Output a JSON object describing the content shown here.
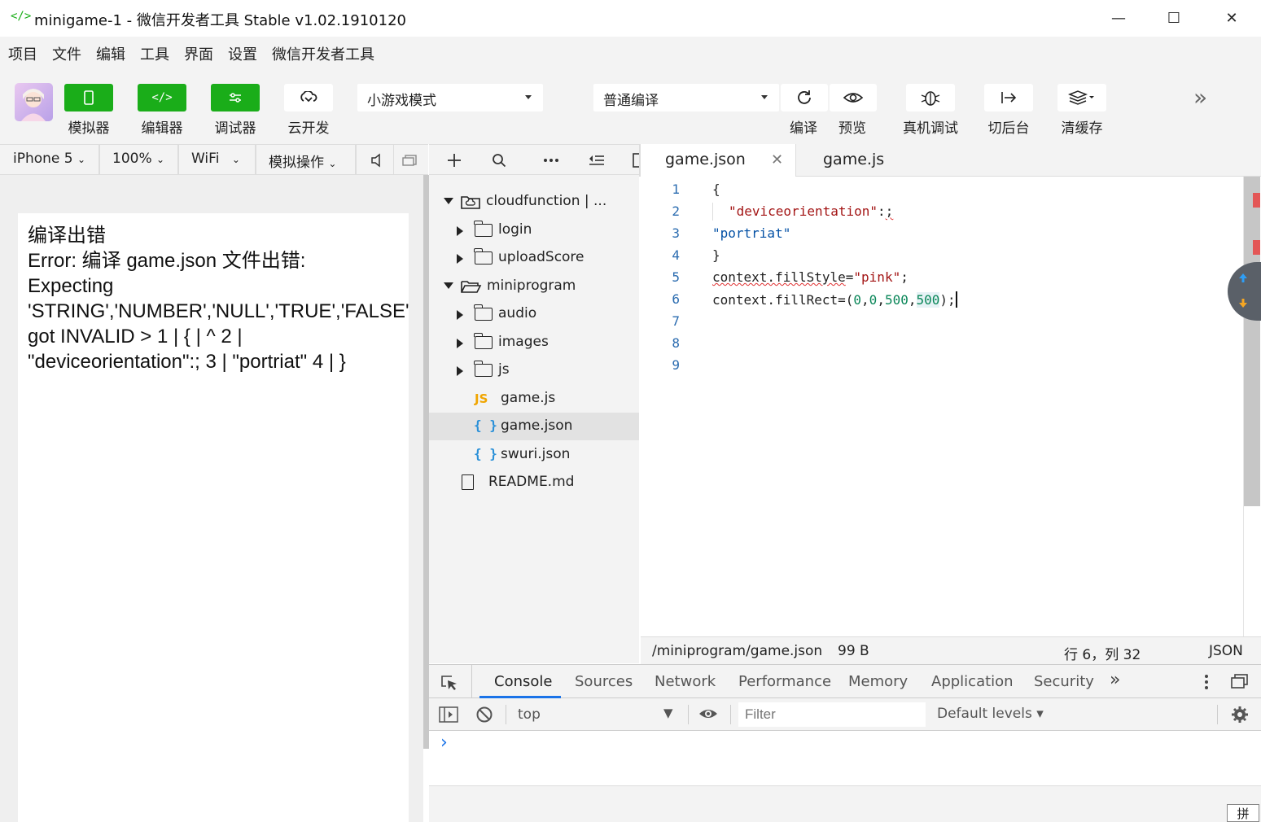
{
  "window": {
    "title": "minigame-1 - 微信开发者工具 Stable v1.02.1910120",
    "app_icon": "</>",
    "minimize": "—",
    "maximize": "☐",
    "close": "✕"
  },
  "menu": [
    "项目",
    "文件",
    "编辑",
    "工具",
    "界面",
    "设置",
    "微信开发者工具"
  ],
  "toolbar": {
    "simulator_label": "模拟器",
    "editor_label": "编辑器",
    "debugger_label": "调试器",
    "cloud_label": "云开发",
    "mode_select": "小游戏模式",
    "compile_select": "普通编译",
    "compile_label": "编译",
    "preview_label": "预览",
    "remote_debug_label": "真机调试",
    "background_label": "切后台",
    "clear_cache_label": "清缓存",
    "more": "»",
    "accent": "#1aad19"
  },
  "simulator_bar": {
    "device": "iPhone 5",
    "zoom": "100%",
    "network": "WiFi",
    "operation": "模拟操作"
  },
  "simulator": {
    "error_text": "编译出错\nError: 编译 game.json 文件出错:\nExpecting\n'STRING','NUMBER','NULL','TRUE','FALSE'\ngot INVALID > 1 | { | ^ 2 |\n\"deviceorientation\":; 3 | \"portriat\" 4 | }"
  },
  "explorer": {
    "items": [
      {
        "label": "cloudfunction | ...",
        "type": "cloud-folder",
        "expanded": true
      },
      {
        "label": "login",
        "type": "folder",
        "expanded": false
      },
      {
        "label": "uploadScore",
        "type": "folder",
        "expanded": false
      },
      {
        "label": "miniprogram",
        "type": "folder",
        "expanded": true
      },
      {
        "label": "audio",
        "type": "folder",
        "expanded": false
      },
      {
        "label": "images",
        "type": "folder",
        "expanded": false
      },
      {
        "label": "js",
        "type": "folder",
        "expanded": false
      },
      {
        "label": "game.js",
        "type": "js"
      },
      {
        "label": "game.json",
        "type": "json",
        "selected": true
      },
      {
        "label": "swuri.json",
        "type": "json"
      },
      {
        "label": "README.md",
        "type": "file"
      }
    ],
    "js_badge": "JS",
    "json_badge": "{ }"
  },
  "editor": {
    "tabs": [
      {
        "label": "game.json",
        "active": true
      },
      {
        "label": "game.js",
        "active": false
      }
    ],
    "line_numbers": [
      "1",
      "2",
      "3",
      "4",
      "5",
      "6",
      "7",
      "8",
      "9"
    ],
    "code": {
      "l1": "{",
      "l2_key": "\"deviceorientation\"",
      "l2_colon": ":",
      "l2_semi": ";",
      "l3": "\"portriat\"",
      "l4": "}",
      "l5_a": "context.fillStyle",
      "l5_eq": "=",
      "l5_str": "\"pink\"",
      "l5_end": ";",
      "l6_a": "context.fillRect=(",
      "l6_n1": "0",
      "l6_c1": ",",
      "l6_n2": "0",
      "l6_c2": ",",
      "l6_n3": "500",
      "l6_c3": ",",
      "l6_n4": "500",
      "l6_end": ");"
    }
  },
  "statusbar": {
    "path": "/miniprogram/game.json",
    "size": "99 B",
    "cursor": "行 6，列 32",
    "language": "JSON"
  },
  "devtools": {
    "tabs": [
      "Console",
      "Sources",
      "Network",
      "Performance",
      "Memory",
      "Application",
      "Security"
    ],
    "active_tab": "Console",
    "more": "»",
    "context": "top",
    "filter_placeholder": "Filter",
    "levels": "Default levels ▾",
    "prompt": "›"
  },
  "ime_indicator": "拼"
}
